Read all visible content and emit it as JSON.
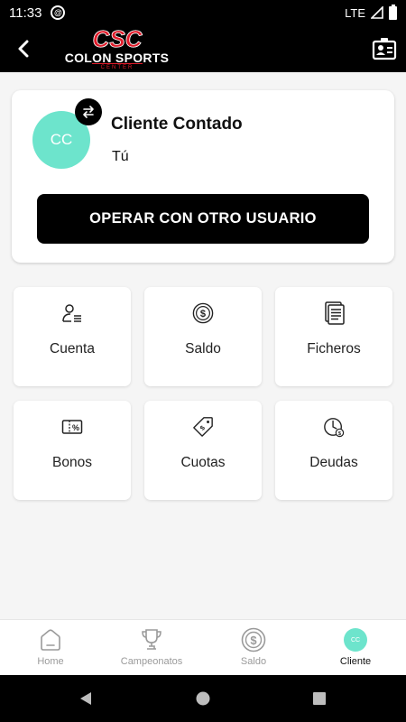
{
  "status_bar": {
    "time": "11:33",
    "network": "LTE"
  },
  "header": {
    "brand_mark": "CSC",
    "brand_name": "COLON SPORTS",
    "brand_sub": "CENTER"
  },
  "user_card": {
    "initials": "CC",
    "name": "Cliente Contado",
    "subtitle": "Tú",
    "operate_button": "OPERAR CON OTRO USUARIO"
  },
  "tiles": [
    {
      "label": "Cuenta",
      "icon": "user-list-icon"
    },
    {
      "label": "Saldo",
      "icon": "dollar-coin-icon"
    },
    {
      "label": "Ficheros",
      "icon": "documents-icon"
    },
    {
      "label": "Bonos",
      "icon": "discount-ticket-icon"
    },
    {
      "label": "Cuotas",
      "icon": "price-tag-icon"
    },
    {
      "label": "Deudas",
      "icon": "clock-debt-icon"
    }
  ],
  "bottom_nav": [
    {
      "label": "Home",
      "icon": "home-icon",
      "active": false
    },
    {
      "label": "Campeonatos",
      "icon": "trophy-icon",
      "active": false
    },
    {
      "label": "Saldo",
      "icon": "dollar-coin-icon",
      "active": false
    },
    {
      "label": "Cliente",
      "icon": "client-avatar-icon",
      "active": true,
      "initials": "CC"
    }
  ],
  "colors": {
    "accent": "#6de4cc",
    "brand_red": "#e01b2a",
    "dark": "#000000"
  }
}
